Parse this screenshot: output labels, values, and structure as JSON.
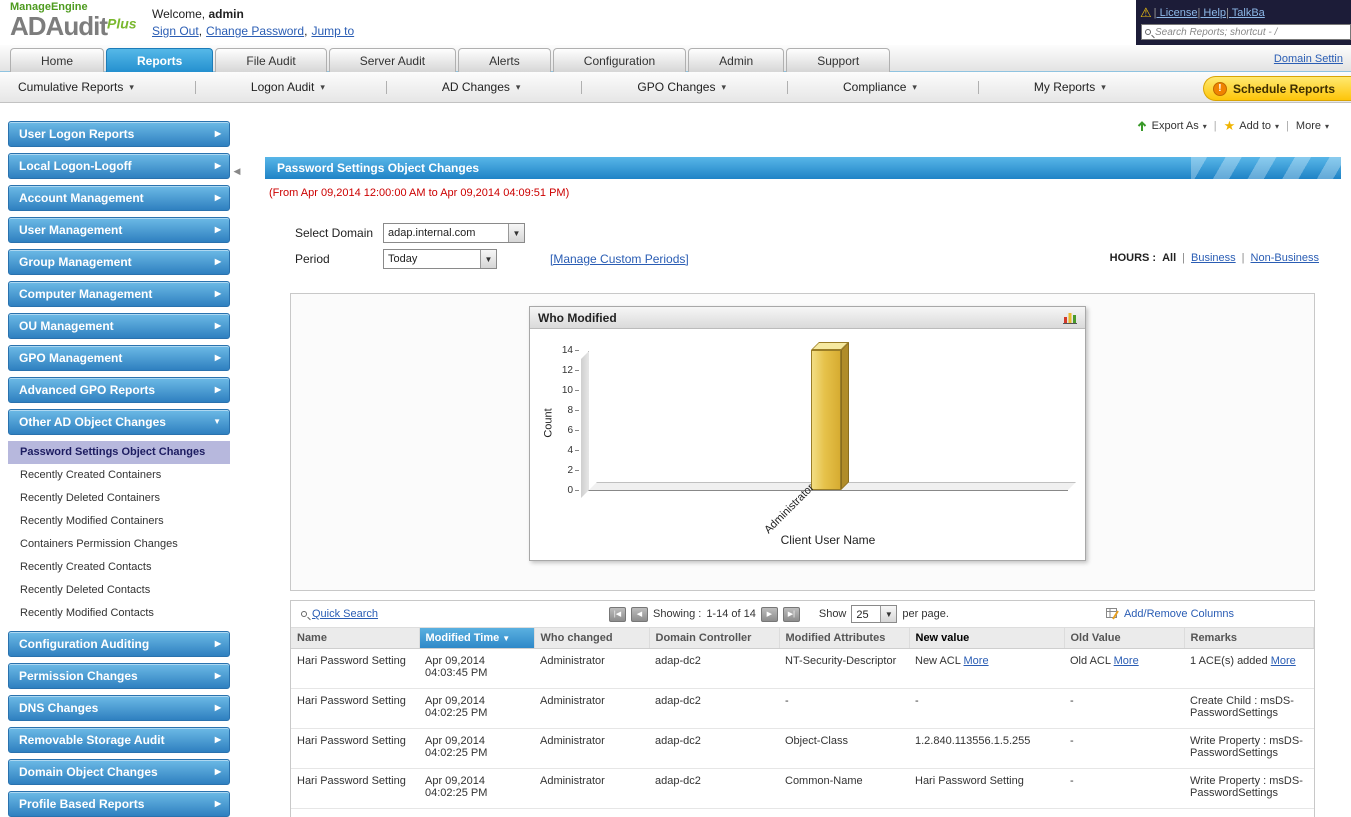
{
  "icons": {
    "dropdown": "▾",
    "select_arrow": "▼",
    "sort_desc": "▼",
    "right_arrow": "▶",
    "down_arrow": "▼",
    "collapse_left": "◀",
    "warning": "⚠",
    "star": "★",
    "schedule_mark": "!",
    "pager_first": "|◀",
    "pager_prev": "◀",
    "pager_next": "▶",
    "pager_last": "▶|"
  },
  "header": {
    "brand": "ManageEngine",
    "product": "ADAudit",
    "product_suffix": "Plus",
    "welcome_label": "Welcome,",
    "username": "admin",
    "account_links": [
      "Sign Out",
      "Change Password",
      "Jump to"
    ],
    "utility_links": [
      "License",
      "Help",
      "TalkBa"
    ],
    "search_placeholder": "Search Reports; shortcut - /"
  },
  "tabs": {
    "items": [
      {
        "label": "Home"
      },
      {
        "label": "Reports",
        "cls": "active"
      },
      {
        "label": "File Audit"
      },
      {
        "label": "Server Audit"
      },
      {
        "label": "Alerts"
      },
      {
        "label": "Configuration"
      },
      {
        "label": "Admin"
      },
      {
        "label": "Support"
      }
    ],
    "right_link": "Domain Settin"
  },
  "menubar": {
    "items": [
      "Cumulative Reports",
      "Logon Audit",
      "AD Changes",
      "GPO Changes",
      "Compliance",
      "My Reports"
    ],
    "schedule_button": "Schedule Reports"
  },
  "sidebar": {
    "top_items": [
      "User Logon Reports",
      "Local Logon-Logoff",
      "Account Management",
      "User Management",
      "Group Management",
      "Computer Management",
      "OU Management",
      "GPO Management",
      "Advanced GPO Reports"
    ],
    "expanded_item": "Other AD Object Changes",
    "selected_sub_item": "Password Settings Object Changes",
    "sub_items": [
      "Recently Created Containers",
      "Recently Deleted Containers",
      "Recently Modified Containers",
      "Containers Permission Changes",
      "Recently Created Contacts",
      "Recently Deleted Contacts",
      "Recently Modified Contacts"
    ],
    "bottom_items": [
      "Configuration Auditing",
      "Permission Changes",
      "DNS Changes",
      "Removable Storage Audit",
      "Domain Object Changes",
      "Profile Based Reports"
    ]
  },
  "toolbar": {
    "export_label": "Export As",
    "add_to_label": "Add to",
    "more_label": "More"
  },
  "report": {
    "title": "Password Settings Object Changes",
    "date_range": "(From Apr 09,2014 12:00:00 AM to Apr 09,2014 04:09:51 PM)",
    "select_domain_label": "Select Domain",
    "domain_value": "adap.internal.com",
    "period_label": "Period",
    "period_value": "Today",
    "manage_periods_link": "[Manage Custom Periods]",
    "hours_label": "HOURS :",
    "hours_all": "All",
    "hours_business": "Business",
    "hours_non_business": "Non-Business"
  },
  "chart_data": {
    "type": "bar",
    "title": "Who Modified",
    "categories": [
      "Administrator"
    ],
    "values": [
      14
    ],
    "xlabel": "Client User Name",
    "ylabel": "Count",
    "ylim": [
      0,
      14
    ],
    "yticks": [
      0,
      2,
      4,
      6,
      8,
      10,
      12,
      14
    ],
    "bar_color": "#e6c24a",
    "grid": false,
    "legend": false
  },
  "table": {
    "quick_search_label": "Quick Search",
    "pagination": {
      "showing_label": "Showing :",
      "range": "1-14 of 14",
      "show_label": "Show",
      "page_size": "25",
      "per_page_label": "per page."
    },
    "add_remove_columns_label": "Add/Remove Columns",
    "columns": [
      {
        "label": "Name"
      },
      {
        "label": "Modified Time",
        "cls": "sorted"
      },
      {
        "label": "Who changed"
      },
      {
        "label": "Domain Controller"
      },
      {
        "label": "Modified Attributes"
      },
      {
        "label": "New value",
        "cls": "strong"
      },
      {
        "label": "Old Value"
      },
      {
        "label": "Remarks"
      }
    ],
    "rows": [
      {
        "name": "Hari Password Setting",
        "modified_time": "Apr 09,2014 04:03:45 PM",
        "who_changed": "Administrator",
        "domain_controller": "adap-dc2",
        "modified_attributes": "NT-Security-Descriptor",
        "new_value": "New ACL",
        "new_value_link": "More",
        "old_value": "Old ACL",
        "old_value_link": "More",
        "remarks": "1 ACE(s) added",
        "remarks_link": "More"
      },
      {
        "name": "Hari Password Setting",
        "modified_time": "Apr 09,2014 04:02:25 PM",
        "who_changed": "Administrator",
        "domain_controller": "adap-dc2",
        "modified_attributes": "-",
        "new_value": "-",
        "new_value_link": "",
        "old_value": "-",
        "old_value_link": "",
        "remarks": "Create Child : msDS-PasswordSettings",
        "remarks_link": ""
      },
      {
        "name": "Hari Password Setting",
        "modified_time": "Apr 09,2014 04:02:25 PM",
        "who_changed": "Administrator",
        "domain_controller": "adap-dc2",
        "modified_attributes": "Object-Class",
        "new_value": "1.2.840.113556.1.5.255",
        "new_value_link": "",
        "old_value": "-",
        "old_value_link": "",
        "remarks": "Write Property : msDS-PasswordSettings",
        "remarks_link": ""
      },
      {
        "name": "Hari Password Setting",
        "modified_time": "Apr 09,2014 04:02:25 PM",
        "who_changed": "Administrator",
        "domain_controller": "adap-dc2",
        "modified_attributes": "Common-Name",
        "new_value": "Hari Password Setting",
        "new_value_link": "",
        "old_value": "-",
        "old_value_link": "",
        "remarks": "Write Property : msDS-PasswordSettings",
        "remarks_link": ""
      }
    ]
  }
}
